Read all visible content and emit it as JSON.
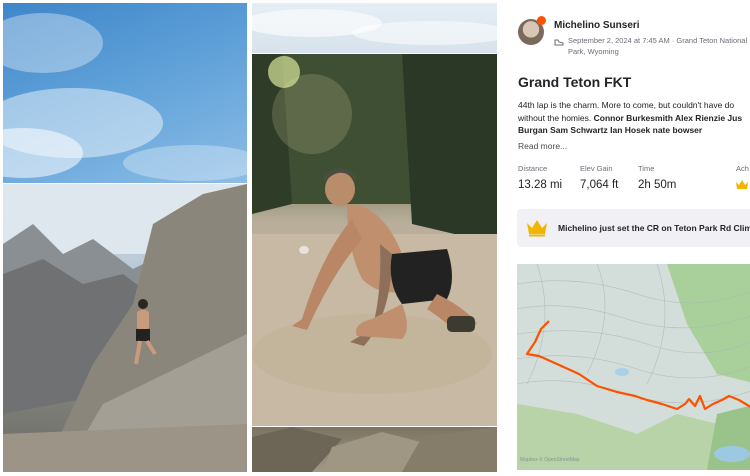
{
  "photos": [
    "sky-photo",
    "runner-on-trail-photo",
    "cloudy-sky-photo",
    "runner-kneeling-photo",
    "rocky-ground-photo"
  ],
  "athlete": {
    "name": "Michelino Sunseri",
    "meta": "September 2, 2024 at 7:45 AM · Grand Teton National Park, Wyoming"
  },
  "activity": {
    "title": "Grand Teton FKT",
    "description_line1": "44th lap is the charm. More to come, but couldn't have do",
    "description_line2_plain": "without the homies. ",
    "description_line2_bold": "Connor Burkesmith Alex Rienzie Jus",
    "description_line3_bold": "Burgan Sam Schwartz Ian Hosek nate bowser",
    "read_more": "Read more..."
  },
  "stats": [
    {
      "label": "Distance",
      "value": "13.28 mi"
    },
    {
      "label": "Elev Gain",
      "value": "7,064 ft"
    },
    {
      "label": "Time",
      "value": "2h 50m"
    },
    {
      "label": "Ach",
      "value": ""
    }
  ],
  "cr_banner": {
    "text": "Michelino just set the CR on Teton Park Rd Clim"
  },
  "map": {
    "credit": "Mapbox © OpenStreetMap",
    "route_color": "#fc5200"
  },
  "colors": {
    "brand": "#fc5200",
    "gold": "#f2b600",
    "text": "#242428",
    "muted": "#6d6d78"
  }
}
